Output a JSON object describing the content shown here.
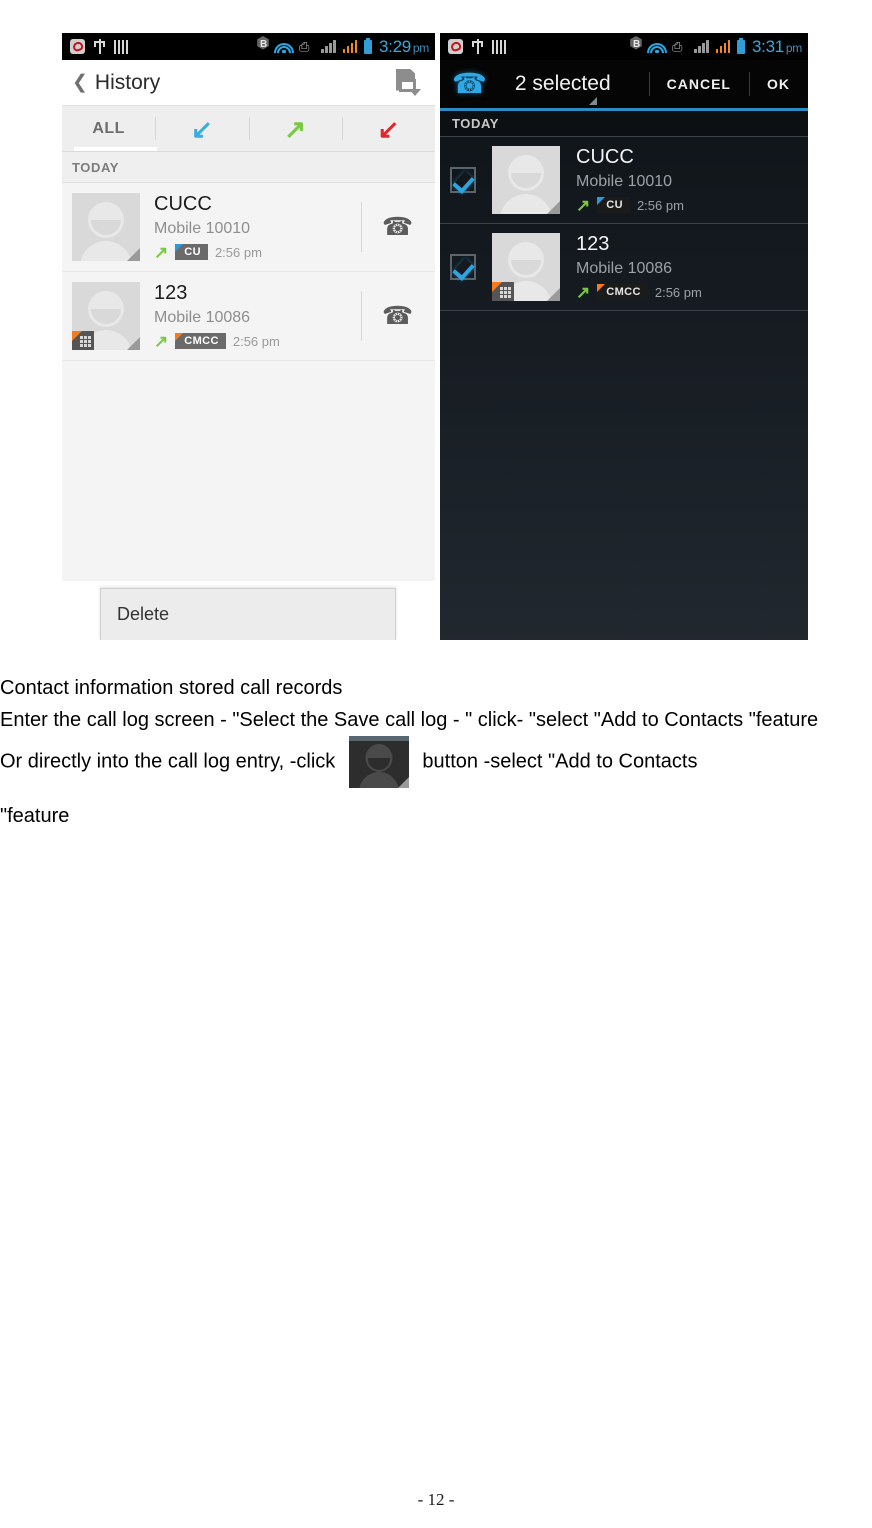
{
  "left_phone": {
    "statusbar": {
      "icons_left": [
        "app-red-icon",
        "usb-icon",
        "bars-icon"
      ],
      "icons_right": [
        "bluetooth-icon",
        "wifi-icon",
        "sync-icon",
        "signal-sim1-icon",
        "signal-sim2-icon",
        "battery-icon"
      ],
      "time": "3:29",
      "meridiem": "pm"
    },
    "actionbar": {
      "back_glyph": "❮",
      "title": "History",
      "menu_icon": "document-dropdown-icon"
    },
    "tabs": [
      {
        "label": "ALL",
        "type": "text",
        "selected": true
      },
      {
        "label": "",
        "type": "icon",
        "icon": "incoming-call-arrow-icon",
        "glyph": "↙",
        "color": "#35aee2",
        "selected": false
      },
      {
        "label": "",
        "type": "icon",
        "icon": "outgoing-call-arrow-icon",
        "glyph": "↗",
        "color": "#7ac943",
        "selected": false
      },
      {
        "label": "",
        "type": "icon",
        "icon": "missed-call-arrow-icon",
        "glyph": "↙",
        "color": "#e3262b",
        "selected": false
      }
    ],
    "section_header": "TODAY",
    "rows": [
      {
        "name": "CUCC",
        "number": "Mobile 10010",
        "direction_icon": "outgoing-call-arrow-icon",
        "direction_glyph": "↗",
        "operator": "CU",
        "operator_color": "#2b9ad6",
        "time": "2:56 pm",
        "has_sim_badge": false,
        "call_icon": "phone-handset-icon"
      },
      {
        "name": "123",
        "number": "Mobile 10086",
        "direction_icon": "outgoing-call-arrow-icon",
        "direction_glyph": "↗",
        "operator": "CMCC",
        "operator_color": "#f47b20",
        "time": "2:56 pm",
        "has_sim_badge": true,
        "call_icon": "phone-handset-icon"
      }
    ],
    "delete_button": "Delete"
  },
  "right_phone": {
    "statusbar": {
      "time": "3:31",
      "meridiem": "pm"
    },
    "actionbar": {
      "phone_icon": "blue-phone-handset-icon",
      "title": "2 selected",
      "cancel_label": "CANCEL",
      "ok_label": "OK"
    },
    "section_header": "TODAY",
    "rows": [
      {
        "checked": true,
        "name": "CUCC",
        "number": "Mobile 10010",
        "direction_glyph": "↗",
        "operator": "CU",
        "operator_color": "#2b9ad6",
        "time": "2:56 pm",
        "has_sim_badge": false
      },
      {
        "checked": true,
        "name": "123",
        "number": "Mobile 10086",
        "direction_glyph": "↗",
        "operator": "CMCC",
        "operator_color": "#f47b20",
        "time": "2:56 pm",
        "has_sim_badge": true
      }
    ]
  },
  "document": {
    "line1": "Contact information stored call records",
    "line2": "Enter the call log screen - \"Select the Save call log - \" click- \"select \"Add to Contacts \"feature",
    "line3_before": "Or directly into the call log entry, -click",
    "line3_after": "button -select \"Add to Contacts",
    "line4": "\"feature",
    "page_number": "- 12 -"
  }
}
